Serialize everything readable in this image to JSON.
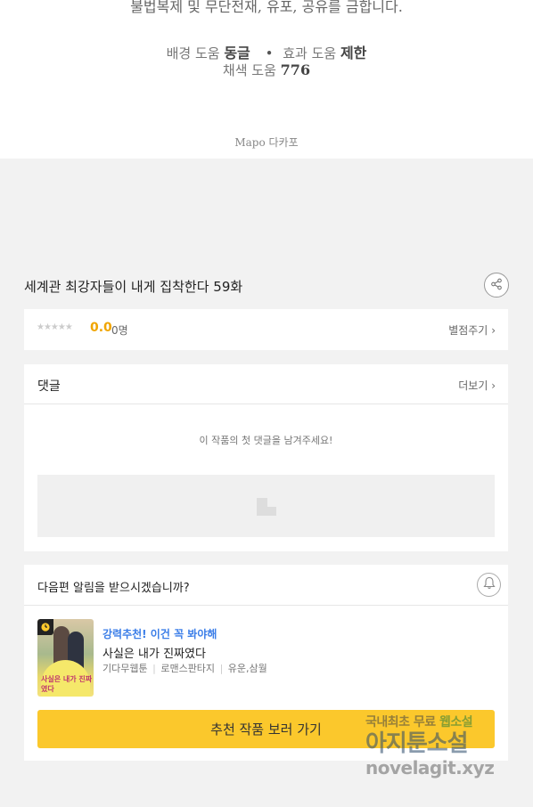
{
  "credits": {
    "notice": "불법복제 및 무단전재, 유포, 공유를 금합니다.",
    "bg_help_label": "배경 도움",
    "bg_help_name": "동글",
    "fx_help_label": "효과 도움",
    "fx_help_name": "제한",
    "color_help_label": "채색 도움",
    "color_help_name": "776",
    "publisher": "Mapo 다카포"
  },
  "episode": {
    "title": "세계관 최강자들이 내게 집착한다 59화"
  },
  "rating": {
    "stars": "★★★★★",
    "score": "0.0",
    "count": "0명",
    "rate_link": "별점주기"
  },
  "comments": {
    "title": "댓글",
    "more": "더보기",
    "empty_message": "이 작품의 첫 댓글을 남겨주세요!"
  },
  "notify": {
    "question": "다음편 알림을 받으시겠습니까?"
  },
  "recommend": {
    "label": "강력추천! 이건 꼭 봐야해",
    "title": "사실은 내가 진짜였다",
    "category": "기다무웹툰",
    "genre": "로맨스판타지",
    "authors": "유운,삼월",
    "thumb_title": "사실은 내가 진짜였다",
    "button": "추천 작품 보러 가기"
  },
  "watermark": {
    "line1_a": "국내최초 무료",
    "line1_b": "웹소설",
    "line2": "아지툰소설",
    "line3": "novelagit.xyz"
  },
  "colors": {
    "accent_yellow": "#fbc82c",
    "score_orange": "#f0a500",
    "label_blue": "#3b7ee8"
  }
}
